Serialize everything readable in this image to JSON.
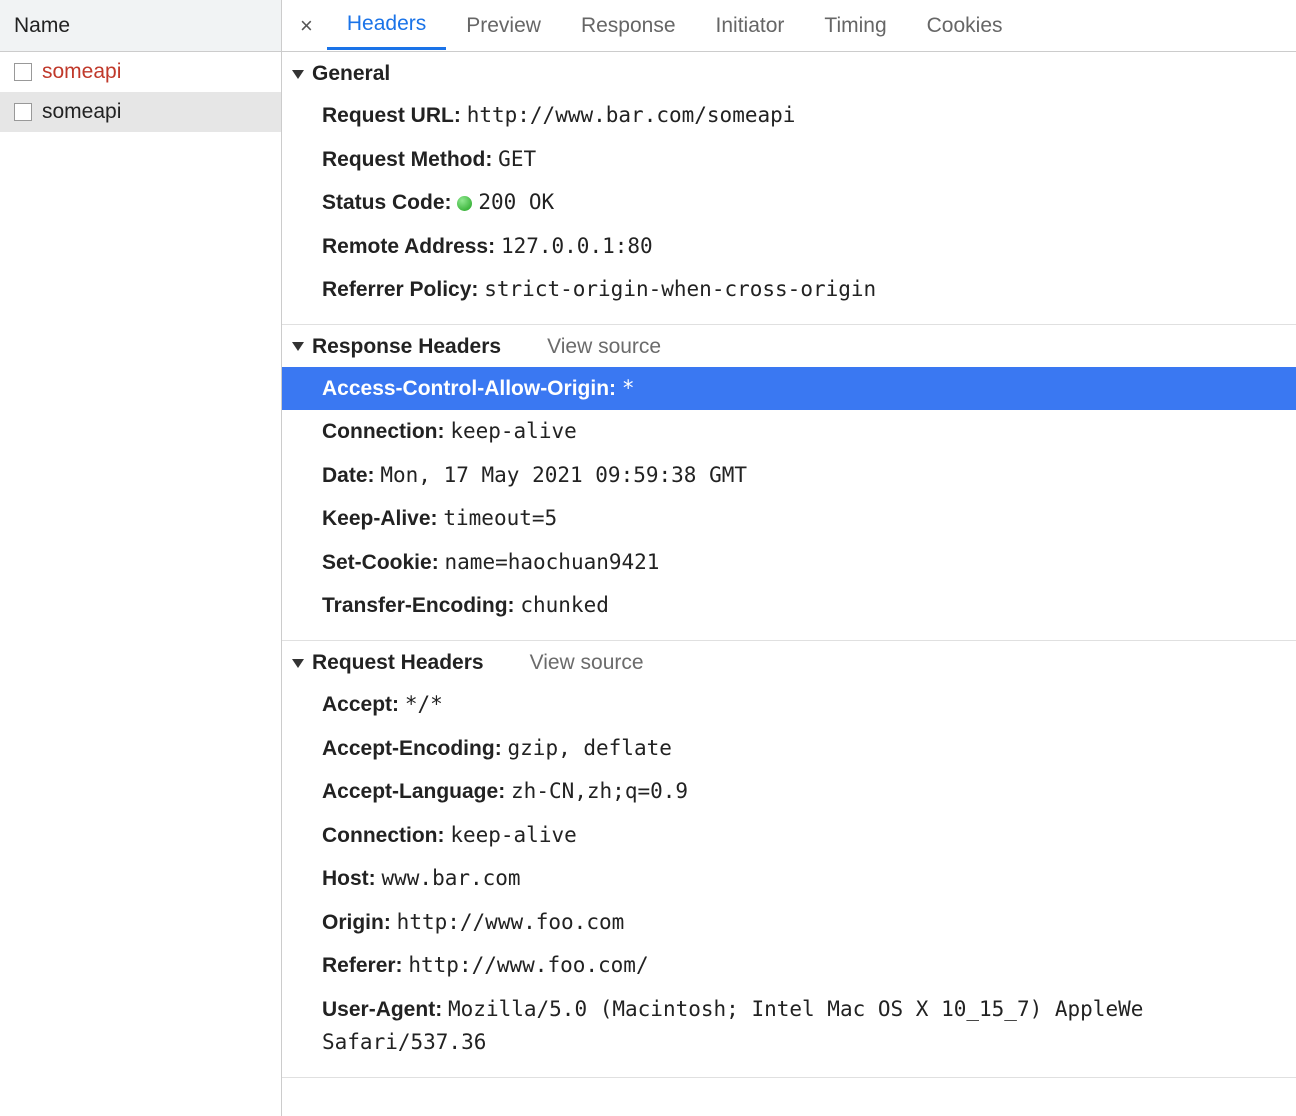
{
  "left": {
    "column_header": "Name",
    "requests": [
      {
        "name": "someapi",
        "error": true,
        "selected": false
      },
      {
        "name": "someapi",
        "error": false,
        "selected": true
      }
    ]
  },
  "tabs": {
    "active": "Headers",
    "items": [
      "Headers",
      "Preview",
      "Response",
      "Initiator",
      "Timing",
      "Cookies"
    ]
  },
  "sections": {
    "general": {
      "title": "General",
      "items": [
        {
          "k": "Request URL",
          "v": "http://www.bar.com/someapi",
          "mono": true
        },
        {
          "k": "Request Method",
          "v": "GET",
          "mono": true
        },
        {
          "k": "Status Code",
          "v": "200 OK",
          "mono": true,
          "status_dot": true
        },
        {
          "k": "Remote Address",
          "v": "127.0.0.1:80",
          "mono": true
        },
        {
          "k": "Referrer Policy",
          "v": "strict-origin-when-cross-origin",
          "mono": true
        }
      ]
    },
    "response_headers": {
      "title": "Response Headers",
      "view_source": "View source",
      "items": [
        {
          "k": "Access-Control-Allow-Origin",
          "v": "*",
          "mono": true,
          "highlight": true
        },
        {
          "k": "Connection",
          "v": "keep-alive",
          "mono": true
        },
        {
          "k": "Date",
          "v": "Mon, 17 May 2021 09:59:38 GMT",
          "mono": true
        },
        {
          "k": "Keep-Alive",
          "v": "timeout=5",
          "mono": true
        },
        {
          "k": "Set-Cookie",
          "v": "name=haochuan9421",
          "mono": true
        },
        {
          "k": "Transfer-Encoding",
          "v": "chunked",
          "mono": true
        }
      ]
    },
    "request_headers": {
      "title": "Request Headers",
      "view_source": "View source",
      "items": [
        {
          "k": "Accept",
          "v": "*/*",
          "mono": true
        },
        {
          "k": "Accept-Encoding",
          "v": "gzip, deflate",
          "mono": true
        },
        {
          "k": "Accept-Language",
          "v": "zh-CN,zh;q=0.9",
          "mono": true
        },
        {
          "k": "Connection",
          "v": "keep-alive",
          "mono": true
        },
        {
          "k": "Host",
          "v": "www.bar.com",
          "mono": true
        },
        {
          "k": "Origin",
          "v": "http://www.foo.com",
          "mono": true
        },
        {
          "k": "Referer",
          "v": "http://www.foo.com/",
          "mono": true
        },
        {
          "k": "User-Agent",
          "v": "Mozilla/5.0 (Macintosh; Intel Mac OS X 10_15_7) AppleWe Safari/537.36",
          "mono": true
        }
      ]
    }
  }
}
